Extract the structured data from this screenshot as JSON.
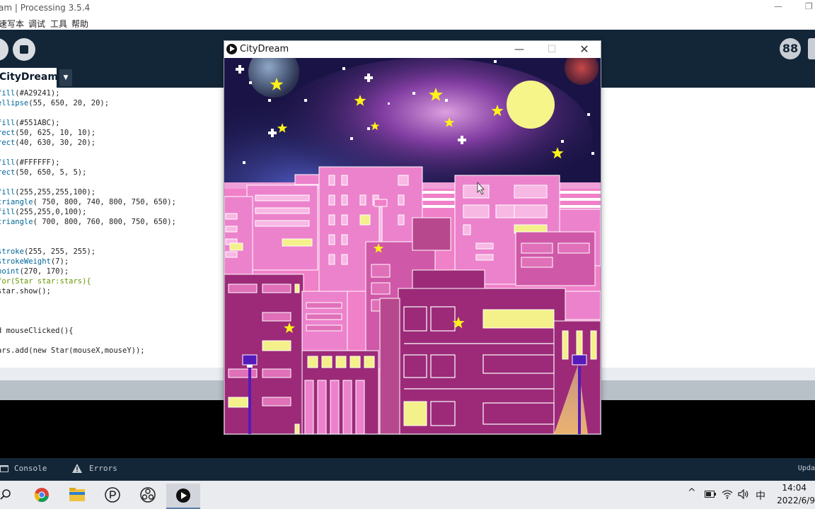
{
  "ide": {
    "title": "am | Processing 3.5.4",
    "minimize": "—",
    "restore": "❐",
    "menu": [
      "速写本",
      "调试",
      "工具",
      "帮助"
    ],
    "mode_label": "88",
    "tab_name": "CityDream",
    "tab_arrow": "▼"
  },
  "code": [
    {
      "text": "fill(#A29241);",
      "kind": "fn"
    },
    {
      "text": "ellipse(55, 650, 20, 20);",
      "kind": "fn"
    },
    {
      "text": "",
      "kind": "blank"
    },
    {
      "text": "fill(#551ABC);",
      "kind": "fn"
    },
    {
      "text": "rect(50, 625, 10, 10);",
      "kind": "fn"
    },
    {
      "text": "rect(40, 630, 30, 20);",
      "kind": "fn"
    },
    {
      "text": "",
      "kind": "blank"
    },
    {
      "text": "fill(#FFFFFF);",
      "kind": "fn"
    },
    {
      "text": "rect(50, 650, 5, 5);",
      "kind": "fn"
    },
    {
      "text": "",
      "kind": "blank"
    },
    {
      "text": "fill(255,255,255,100);",
      "kind": "fn"
    },
    {
      "text": "triangle( 750, 800, 740, 800, 750, 650);",
      "kind": "fn"
    },
    {
      "text": "fill(255,255,0,100);",
      "kind": "fn"
    },
    {
      "text": "triangle( 700, 800, 760, 800, 750, 650);",
      "kind": "fn"
    },
    {
      "text": "",
      "kind": "blank"
    },
    {
      "text": "",
      "kind": "blank"
    },
    {
      "text": "stroke(255, 255, 255);",
      "kind": "fn"
    },
    {
      "text": "strokeWeight(7);",
      "kind": "fn"
    },
    {
      "text": "point(270, 170);",
      "kind": "fn"
    },
    {
      "text": "for(Star star:stars){",
      "kind": "for"
    },
    {
      "text": "star.show();",
      "kind": "plain"
    },
    {
      "text": "",
      "kind": "blank"
    },
    {
      "text": "",
      "kind": "blank"
    },
    {
      "text": "",
      "kind": "blank"
    },
    {
      "text": "d mouseClicked(){",
      "kind": "fn"
    },
    {
      "text": "",
      "kind": "blank"
    },
    {
      "text": "ars.add(new Star(mouseX,mouseY));",
      "kind": "add"
    }
  ],
  "console": {
    "tab_console": "Console",
    "tab_errors": "Errors",
    "update": "Upda"
  },
  "sketch": {
    "title": "CityDream",
    "minimize": "—",
    "maximize": "☐",
    "close": "✕"
  },
  "colors": {
    "ide_dark": "#132638",
    "sky_dark": "#1a1446",
    "moon": "#f5f58a",
    "star": "#fff21a",
    "building_pink": "#f080c8",
    "building_magenta": "#9c2a78",
    "window_yellow": "#f4f08a"
  },
  "taskbar": {
    "apps": [
      "search-icon",
      "chrome-icon",
      "file-explorer-icon",
      "processing-icon",
      "obs-icon",
      "media-player-icon"
    ],
    "tray": {
      "up_arrow": "^",
      "ime": "中"
    },
    "time": "14:04",
    "date": "2022/6/9"
  }
}
